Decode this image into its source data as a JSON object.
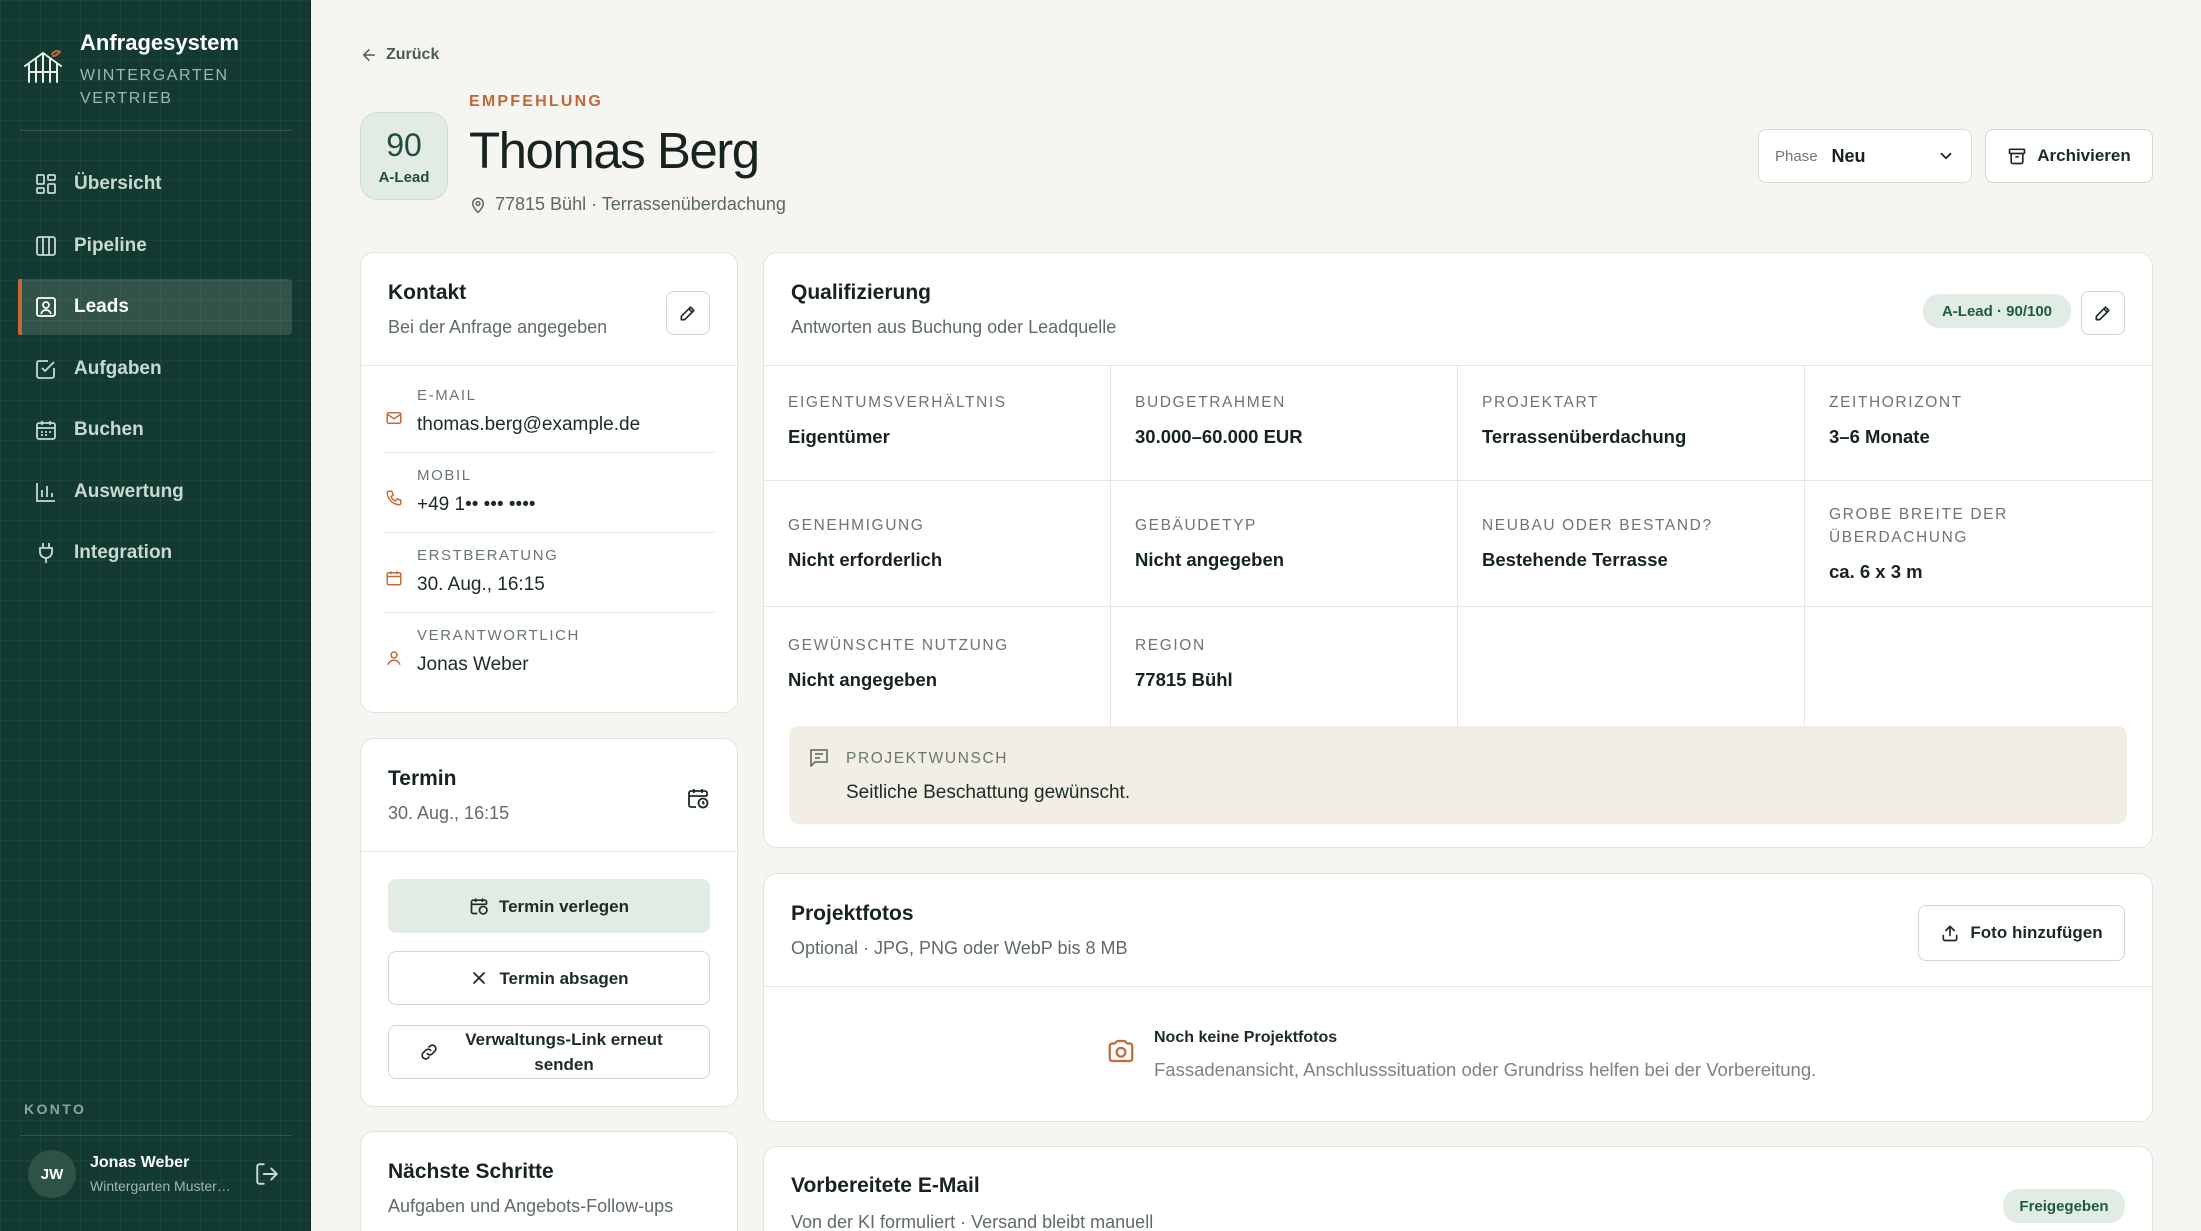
{
  "brand": {
    "title": "Anfragesystem",
    "subtitle": "WINTERGARTEN VERTRIEB"
  },
  "nav": [
    {
      "label": "Übersicht",
      "icon": "dashboard-icon"
    },
    {
      "label": "Pipeline",
      "icon": "pipeline-icon"
    },
    {
      "label": "Leads",
      "icon": "leads-icon",
      "active": true
    },
    {
      "label": "Aufgaben",
      "icon": "task-icon"
    },
    {
      "label": "Buchen",
      "icon": "calendar-icon"
    },
    {
      "label": "Auswertung",
      "icon": "chart-icon"
    },
    {
      "label": "Integration",
      "icon": "plug-icon"
    }
  ],
  "account": {
    "section_label": "KONTO",
    "initials": "JW",
    "name": "Jonas Weber",
    "org": "Wintergarten Musterbau"
  },
  "header": {
    "back_label": "Zurück",
    "score": "90",
    "score_label": "A-Lead",
    "eyebrow": "EMPFEHLUNG",
    "name": "Thomas Berg",
    "location": "77815 Bühl · Terrassenüberdachung",
    "phase_label": "Phase",
    "phase_value": "Neu",
    "archive_label": "Archivieren"
  },
  "contact": {
    "title": "Kontakt",
    "subtitle": "Bei der Anfrage angegeben",
    "rows": [
      {
        "label": "E-MAIL",
        "value": "thomas.berg@example.de",
        "icon": "mail-icon"
      },
      {
        "label": "MOBIL",
        "value": "+49 1•• ••• ••••",
        "icon": "phone-icon"
      },
      {
        "label": "ERSTBERATUNG",
        "value": "30. Aug., 16:15",
        "icon": "calendar-icon"
      },
      {
        "label": "VERANTWORTLICH",
        "value": "Jonas Weber",
        "icon": "user-icon"
      }
    ]
  },
  "appointment": {
    "title": "Termin",
    "subtitle": "30. Aug., 16:15",
    "reschedule_label": "Termin verlegen",
    "cancel_label": "Termin absagen",
    "resend_label": "Verwaltungs-Link erneut senden"
  },
  "next_steps": {
    "title": "Nächste Schritte",
    "subtitle": "Aufgaben und Angebots-Follow-ups"
  },
  "qualification": {
    "title": "Qualifizierung",
    "subtitle": "Antworten aus Buchung oder Leadquelle",
    "badge": "A-Lead · 90/100",
    "fields": [
      {
        "label": "EIGENTUMSVERHÄLTNIS",
        "value": "Eigentümer"
      },
      {
        "label": "BUDGETRAHMEN",
        "value": "30.000–60.000 EUR"
      },
      {
        "label": "PROJEKTART",
        "value": "Terrassenüberdachung"
      },
      {
        "label": "ZEITHORIZONT",
        "value": "3–6 Monate"
      },
      {
        "label": "GENEHMIGUNG",
        "value": "Nicht erforderlich"
      },
      {
        "label": "GEBÄUDETYP",
        "value": "Nicht angegeben"
      },
      {
        "label": "NEUBAU ODER BESTAND?",
        "value": "Bestehende Terrasse"
      },
      {
        "label": "GROBE BREITE DER ÜBERDACHUNG",
        "value": "ca. 6 x 3 m"
      },
      {
        "label": "GEWÜNSCHTE NUTZUNG",
        "value": "Nicht angegeben"
      },
      {
        "label": "REGION",
        "value": "77815 Bühl"
      }
    ],
    "wish_label": "PROJEKTWUNSCH",
    "wish_value": "Seitliche Beschattung gewünscht."
  },
  "photos": {
    "title": "Projektfotos",
    "subtitle": "Optional · JPG, PNG oder WebP bis 8 MB",
    "add_label": "Foto hinzufügen",
    "empty_title": "Noch keine Projektfotos",
    "empty_text": "Fassadenansicht, Anschlusssituation oder Grundriss helfen bei der Vorbereitung."
  },
  "email": {
    "title": "Vorbereitete E-Mail",
    "subtitle": "Von der KI formuliert · Versand bleibt manuell",
    "badge": "Freigegeben"
  },
  "colors": {
    "sidebar": "#133a30",
    "accent": "#c36a3b",
    "badge_bg": "#e1ece5",
    "wish_bg": "#f2eee6"
  }
}
